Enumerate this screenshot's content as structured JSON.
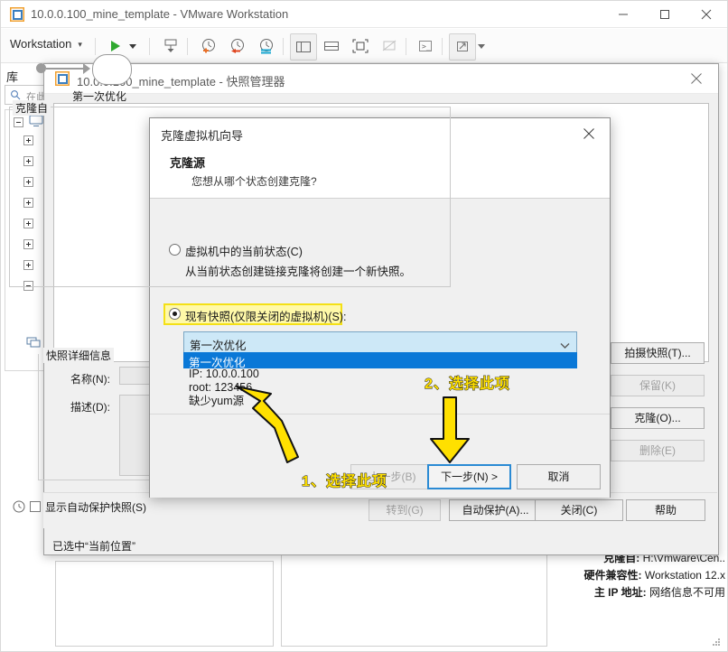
{
  "vmware_window": {
    "title": "10.0.0.100_mine_template - VMware Workstation",
    "icon": "vmware-app-icon",
    "caption": {
      "minimize": "minimize-icon",
      "maximize": "maximize-icon",
      "close": "close-icon"
    },
    "toolbar": {
      "menu_label": "Workstation",
      "menu_caret": "▾",
      "buttons": [
        {
          "name": "power-on-icon"
        },
        {
          "name": "power-dropdown-caret-icon"
        },
        {
          "name": "send-ctrl-alt-del-icon"
        },
        {
          "name": "take-snapshot-icon"
        },
        {
          "name": "revert-snapshot-icon"
        },
        {
          "name": "snapshot-manager-icon"
        },
        {
          "name": "show-library-icon"
        },
        {
          "name": "show-thumbnail-bar-icon"
        },
        {
          "name": "full-screen-icon"
        },
        {
          "name": "unity-mode-icon"
        },
        {
          "name": "console-view-icon"
        },
        {
          "name": "expand-icon"
        },
        {
          "name": "expand-caret-icon"
        }
      ]
    },
    "library": {
      "label": "库",
      "search_placeholder": "在此处键入内容以进行搜索"
    },
    "vm_details": [
      {
        "key": "克隆自:",
        "value": "H:\\Vmware\\Cen.."
      },
      {
        "key": "硬件兼容性:",
        "value": "Workstation 12.x"
      },
      {
        "key": "主 IP 地址:",
        "value": "网络信息不可用"
      }
    ]
  },
  "snapshot_manager": {
    "title": "10.0.0.100_mine_template - 快照管理器",
    "icon": "vmware-app-icon",
    "close_icon": "close-icon",
    "tree": {
      "snapshot_label": "第一次优化",
      "node_icon": "snapshot-node-icon"
    },
    "details": {
      "legend": "快照详细信息",
      "name_label": "名称(N):",
      "name_value": "",
      "desc_label": "描述(D):",
      "desc_value": ""
    },
    "side_buttons": [
      {
        "label": "拍摄快照(T)...",
        "enabled": true
      },
      {
        "label": "保留(K)",
        "enabled": false
      },
      {
        "label": "克隆(O)...",
        "enabled": true
      },
      {
        "label": "删除(E)",
        "enabled": false
      }
    ],
    "footer": {
      "clock_icon": "history-clock-icon",
      "autoprotect_checkbox_label": "显示自动保护快照(S)",
      "autoprotect_checked": false,
      "buttons": [
        {
          "label": "转到(G)",
          "enabled": false
        },
        {
          "label": "自动保护(A)...",
          "enabled": true
        },
        {
          "label": "关闭(C)",
          "enabled": true
        },
        {
          "label": "帮助",
          "enabled": true
        }
      ]
    },
    "status_text": "已选中“当前位置”"
  },
  "clone_wizard": {
    "title": "克隆虚拟机向导",
    "close_icon": "close-icon",
    "header_title": "克隆源",
    "header_subtitle": "您想从哪个状态创建克隆?",
    "group_legend": "克隆自",
    "option_current": {
      "label": "虚拟机中的当前状态(C)",
      "description": "从当前状态创建链接克隆将创建一个新快照。",
      "selected": false
    },
    "option_snapshot": {
      "label": "现有快照(仅限关闭的虚拟机)(S):",
      "selected": true,
      "highlighted": true
    },
    "combo": {
      "value": "第一次优化",
      "arrow_icon": "chevron-down-icon",
      "options": [
        "第一次优化"
      ],
      "highlighted_option": "第一次优化"
    },
    "snapshot_info": "IP: 10.0.0.100\nroot: 123456\n缺少yum源",
    "buttons": [
      {
        "label": "上一步(B)",
        "enabled": false,
        "primary": false
      },
      {
        "label": "下一步(N) >",
        "enabled": true,
        "primary": true
      },
      {
        "label": "取消",
        "enabled": true,
        "primary": false
      }
    ]
  },
  "annotations": [
    {
      "id": "step1",
      "text": "1、选择此项",
      "color": "#ffe000",
      "arrow": "arrow-up-left"
    },
    {
      "id": "step2",
      "text": "2、选择此项",
      "color": "#ffe000",
      "arrow": "arrow-down"
    }
  ]
}
